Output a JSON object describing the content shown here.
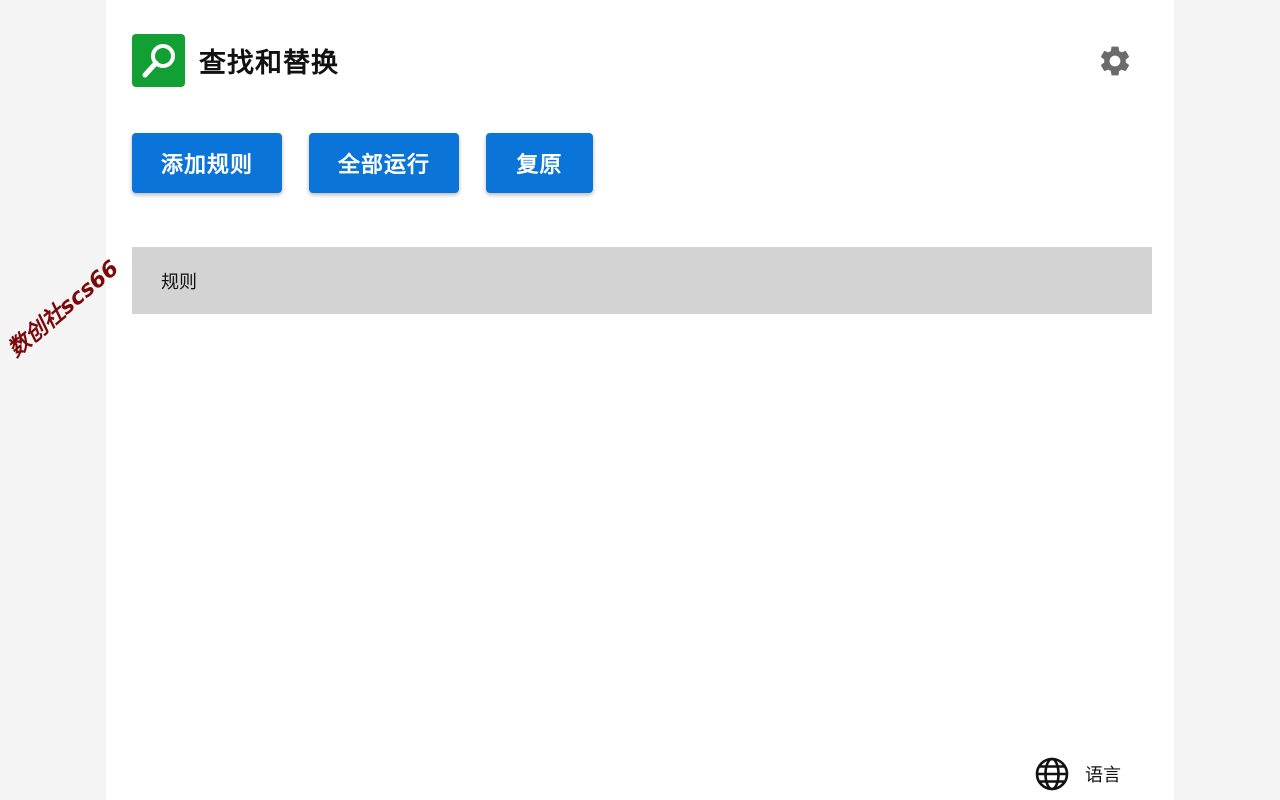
{
  "app": {
    "title": "查找和替换"
  },
  "toolbar": {
    "add_rule_label": "添加规则",
    "run_all_label": "全部运行",
    "restore_label": "复原"
  },
  "rules": {
    "header_label": "规则"
  },
  "footer": {
    "language_label": "语言"
  },
  "watermark": {
    "text": "数创社scs66"
  },
  "icons": {
    "logo": "magnifier-icon",
    "settings": "gear-icon",
    "language": "globe-icon"
  },
  "colors": {
    "logo_bg": "#129f34",
    "button_bg": "#0a74d9",
    "rules_header_bg": "#d3d3d3",
    "gear": "#6b6b6b"
  }
}
